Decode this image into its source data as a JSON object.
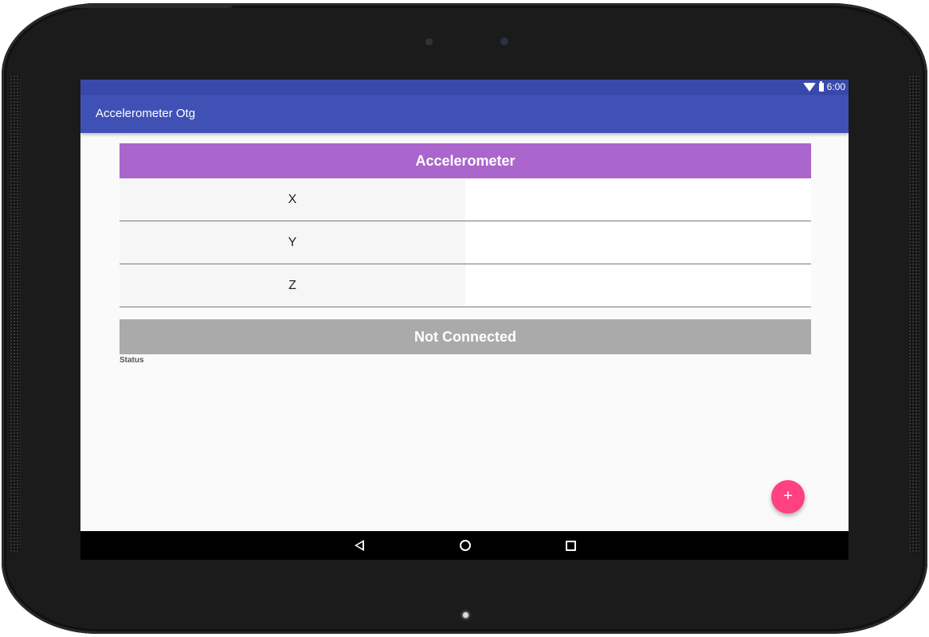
{
  "status_bar": {
    "time": "6:00",
    "icons": [
      "wifi-icon",
      "battery-icon"
    ]
  },
  "app_bar": {
    "title": "Accelerometer Otg"
  },
  "sensor": {
    "header": "Accelerometer",
    "axes": [
      {
        "label": "X",
        "value": ""
      },
      {
        "label": "Y",
        "value": ""
      },
      {
        "label": "Z",
        "value": ""
      }
    ]
  },
  "connection": {
    "state": "Not Connected",
    "label": "Status"
  },
  "fab": {
    "glyph": "+",
    "icon": "add-icon"
  },
  "nav_bar": {
    "icons": [
      "back-icon",
      "home-icon",
      "recent-apps-icon"
    ]
  },
  "colors": {
    "status_bar": "#3949ab",
    "app_bar": "#3f51b5",
    "header": "#aa66cc",
    "connection_bar": "#aaaaaa",
    "fab": "#ff4081"
  }
}
